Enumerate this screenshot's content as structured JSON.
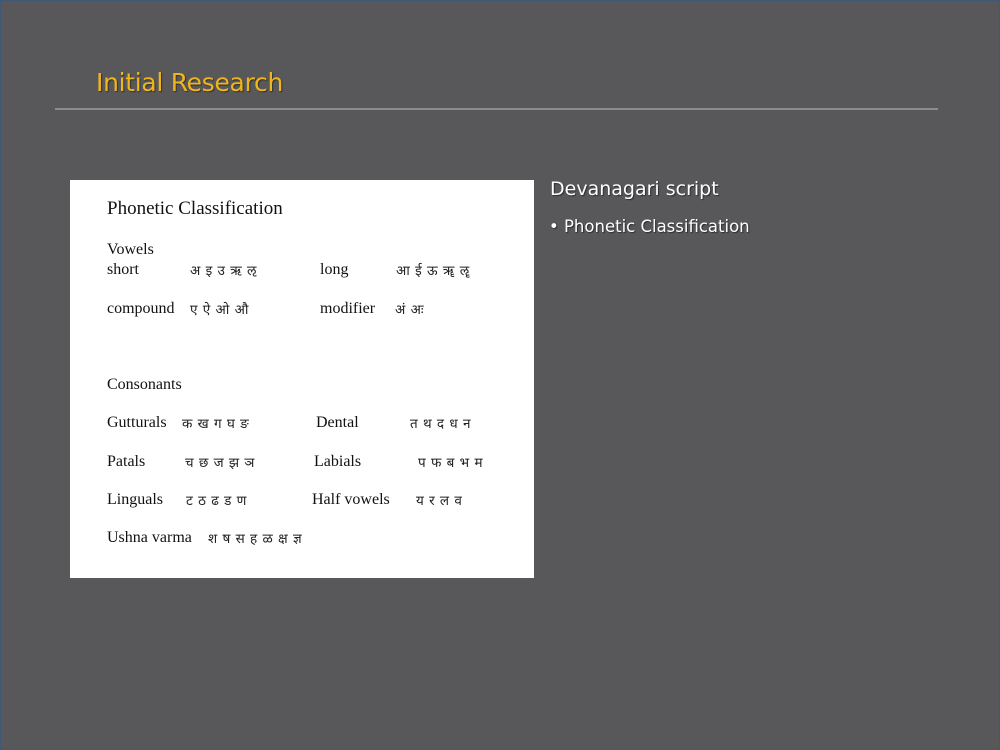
{
  "slide": {
    "title": "Initial Research",
    "side_title": "Devanagari script",
    "bullet_marker": "•",
    "bullet_text": "Phonetic Classification",
    "colors": {
      "background": "#58585a",
      "title": "#f1b51c",
      "text": "#ffffff",
      "rule": "#8c8c8c"
    }
  },
  "figure": {
    "heading": "Phonetic Classification",
    "vowels_heading": "Vowels",
    "short_label": "short",
    "short_chars": "अ इ उ ऋ ऌ",
    "long_label": "long",
    "long_chars": "आ ई ऊ ॠ ॡ",
    "compound_label": "compound",
    "compound_chars": "ए ऐ ओ औ",
    "modifier_label": "modifier",
    "modifier_chars": "अं अः",
    "consonants_heading": "Consonants",
    "gutturals_label": "Gutturals",
    "gutturals_chars": "क ख ग घ ङ",
    "dental_label": "Dental",
    "dental_chars": "त थ द ध न",
    "patals_label": "Patals",
    "patals_chars": "च छ ज झ ञ",
    "labials_label": "Labials",
    "labials_chars": "प फ ब भ म",
    "linguals_label": "Linguals",
    "linguals_chars": "ट ठ ढ ड ण",
    "halfvowels_label": "Half vowels",
    "halfvowels_chars": "य र ल व",
    "ushna_label": "Ushna varma",
    "ushna_chars": "श ष स ह ळ क्ष ज्ञ"
  }
}
